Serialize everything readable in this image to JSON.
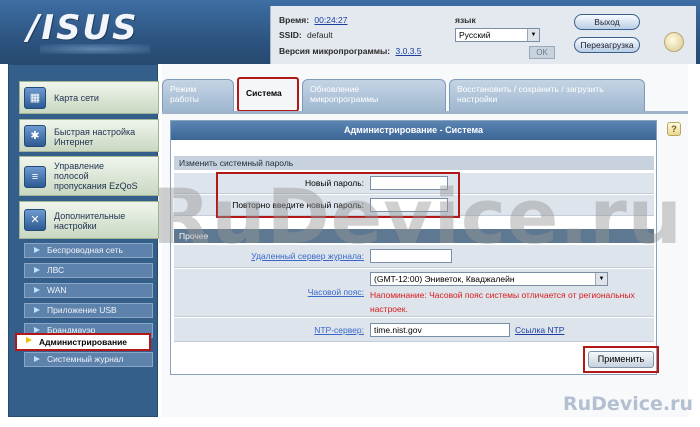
{
  "header": {
    "logo": "/ISUS",
    "time_label": "Время:",
    "time_value": "00:24:27",
    "ssid_label": "SSID:",
    "ssid_value": "default",
    "firmware_label": "Версия микропрограммы:",
    "firmware_value": "3.0.3.5",
    "language_label": "язык",
    "language_value": "Русский",
    "ok_label": "OK",
    "logout_label": "Выход",
    "reboot_label": "Перезагрузка"
  },
  "sidebar": {
    "big_items": [
      {
        "label_1": "Карта сети",
        "label_2": ""
      },
      {
        "label_1": "Быстрая настройка",
        "label_2": "Интернет"
      },
      {
        "label_1": "Управление",
        "label_2": "полосой",
        "label_3": "пропускания EzQoS"
      },
      {
        "label_1": "Дополнительные",
        "label_2": "настройки"
      }
    ],
    "sub_items": [
      {
        "label": "Беспроводная сеть"
      },
      {
        "label": "ЛВС"
      },
      {
        "label": "WAN"
      },
      {
        "label": "Приложение USB"
      },
      {
        "label": "Брандмауэр"
      },
      {
        "label": "Администрирование"
      },
      {
        "label": "Системный журнал"
      }
    ]
  },
  "tabs": [
    {
      "label_1": "Режим",
      "label_2": "работы"
    },
    {
      "label_1": "Система",
      "label_2": ""
    },
    {
      "label_1": "Обновление",
      "label_2": "микропрограммы"
    },
    {
      "label_1": "Восстановить / сохранить / загрузить",
      "label_2": "настройки"
    }
  ],
  "panel": {
    "title": "Администрирование - Система",
    "password_section": "Изменить системный пароль",
    "new_password_label": "Новый пароль:",
    "confirm_password_label": "Повторно введите новый пароль:",
    "misc_section": "Прочее",
    "log_server_label": "Удаленный сервер журнала:",
    "timezone_label": "Часовой пояс:",
    "timezone_value": "(GMT-12:00) Эниветок, Кваджалейн",
    "timezone_warning": "Напоминание: Часовой пояс системы отличается от региональных настроек.",
    "ntp_label": "NTP-сервер:",
    "ntp_value": "time.nist.gov",
    "ntp_link": "Ссылка NTP",
    "apply_label": "Применить"
  },
  "watermark": {
    "big": "RuDevice.ru",
    "small": "RuDevice.ru"
  }
}
